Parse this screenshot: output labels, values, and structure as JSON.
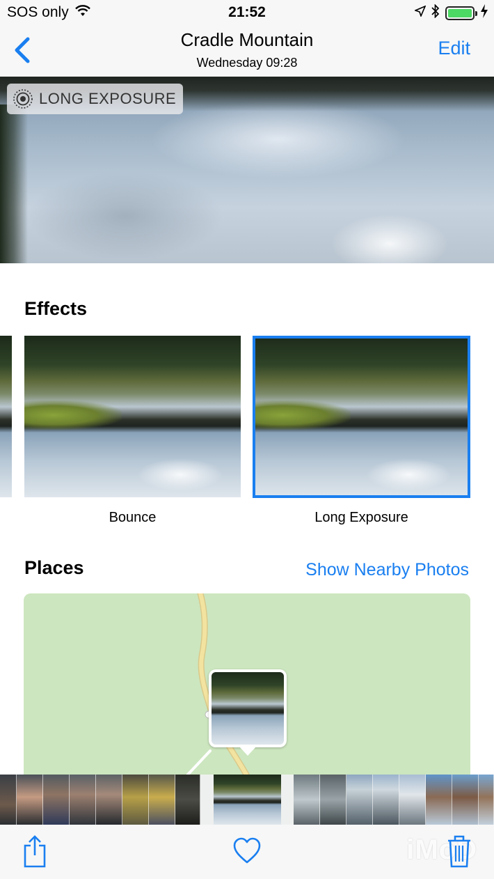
{
  "status_bar": {
    "carrier": "SOS only",
    "time": "21:52",
    "battery_level": 1.0,
    "icons": [
      "wifi-icon",
      "location-arrow-icon",
      "bluetooth-icon",
      "battery-icon",
      "charging-bolt-icon"
    ]
  },
  "nav": {
    "title": "Cradle Mountain",
    "subtitle": "Wednesday  09:28",
    "edit_label": "Edit",
    "back_icon": "chevron-left-icon"
  },
  "hero": {
    "badge_label": "LONG EXPOSURE",
    "badge_icon": "live-photo-icon"
  },
  "effects": {
    "heading": "Effects",
    "items": [
      {
        "label": "Bounce",
        "selected": false
      },
      {
        "label": "Long Exposure",
        "selected": true
      }
    ]
  },
  "places": {
    "heading": "Places",
    "nearby_label": "Show Nearby Photos"
  },
  "toolbar": {
    "share_icon": "share-icon",
    "favorite_icon": "heart-icon",
    "delete_icon": "trash-icon",
    "watermark": "iMoD"
  },
  "colors": {
    "accent": "#1a7ff0",
    "map_green": "#cce6bf",
    "road": "#f3e3a0",
    "battery": "#4cd964"
  }
}
